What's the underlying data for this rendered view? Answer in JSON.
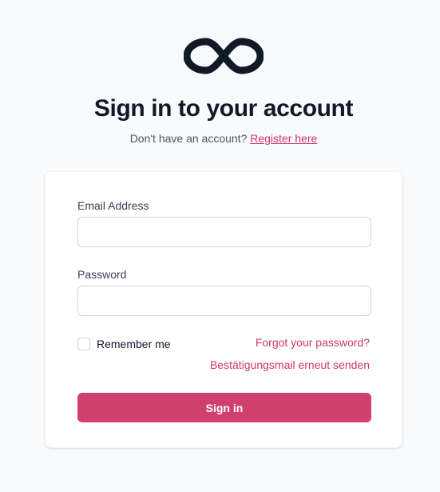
{
  "header": {
    "logo_icon": "infinity-logo-icon",
    "title": "Sign in to your account",
    "subtitle_text": "Don't have an account?",
    "register_link": "Register here"
  },
  "form": {
    "email_label": "Email Address",
    "email_value": "",
    "email_placeholder": "",
    "password_label": "Password",
    "password_value": "",
    "password_placeholder": "",
    "remember_label": "Remember me",
    "remember_checked": false,
    "forgot_link": "Forgot your password?",
    "resend_link": "Bestätigungsmail erneut senden",
    "signin_label": "Sign in"
  },
  "colors": {
    "accent": "#d0356f",
    "button": "#d0406f",
    "heading": "#111827",
    "background": "#f9fafb"
  }
}
